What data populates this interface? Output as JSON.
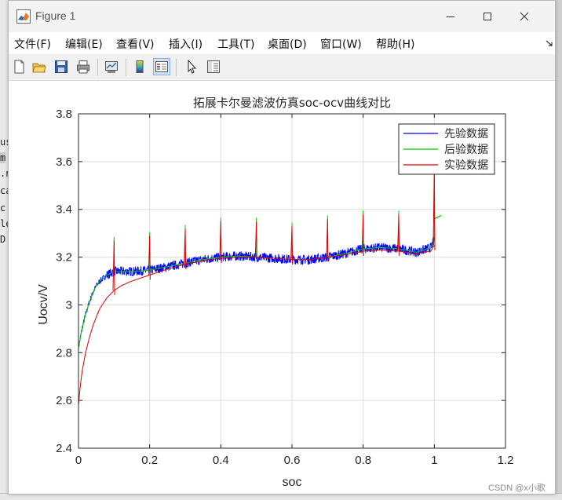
{
  "window": {
    "title": "Figure 1",
    "menu": [
      "文件(F)",
      "编辑(E)",
      "查看(V)",
      "插入(I)",
      "工具(T)",
      "桌面(D)",
      "窗口(W)",
      "帮助(H)"
    ]
  },
  "background_fragments": [
    "us",
    "m",
    ".n",
    "ca",
    "c.",
    "le",
    "D"
  ],
  "watermark": "CSDN @x小歌",
  "colors": {
    "series1": "#0000ff",
    "series2": "#00cc00",
    "series3": "#dd0000",
    "grid": "#dcdcdc"
  },
  "toolbar_icons": [
    "new-figure-icon",
    "open-file-icon",
    "save-icon",
    "print-icon",
    "link-plot-icon",
    "colorbar-icon",
    "legend-icon",
    "pointer-icon",
    "property-inspector-icon"
  ],
  "chart_data": {
    "type": "line",
    "title": "拓展卡尔曼滤波仿真soc-ocv曲线对比",
    "xlabel": "soc",
    "ylabel": "Uocv/V",
    "xlim": [
      0,
      1.2
    ],
    "ylim": [
      2.4,
      3.8
    ],
    "xticks": [
      0,
      0.2,
      0.4,
      0.6,
      0.8,
      1,
      1.2
    ],
    "xtick_labels": [
      "0",
      "0.2",
      "0.4",
      "0.6",
      "0.8",
      "1",
      "1.2"
    ],
    "yticks": [
      2.4,
      2.6,
      2.8,
      3.0,
      3.2,
      3.4,
      3.6,
      3.8
    ],
    "ytick_labels": [
      "2.4",
      "2.6",
      "2.8",
      "3",
      "3.2",
      "3.4",
      "3.6",
      "3.8"
    ],
    "grid": true,
    "legend_position": "top-right",
    "series": [
      {
        "name": "先验数据",
        "color": "#0000ff",
        "noise": 0.02,
        "x": [
          0,
          0.01,
          0.02,
          0.03,
          0.04,
          0.05,
          0.06,
          0.08,
          0.1,
          0.12,
          0.15,
          0.2,
          0.25,
          0.3,
          0.35,
          0.4,
          0.45,
          0.5,
          0.55,
          0.6,
          0.65,
          0.7,
          0.75,
          0.8,
          0.85,
          0.9,
          0.95,
          0.99,
          1.0
        ],
        "y": [
          2.82,
          2.9,
          2.96,
          3.01,
          3.05,
          3.08,
          3.1,
          3.125,
          3.14,
          3.14,
          3.14,
          3.145,
          3.16,
          3.175,
          3.19,
          3.2,
          3.205,
          3.2,
          3.195,
          3.19,
          3.19,
          3.2,
          3.215,
          3.235,
          3.24,
          3.235,
          3.22,
          3.24,
          3.27
        ]
      },
      {
        "name": "后验数据",
        "color": "#00cc00",
        "x": [
          0,
          0.01,
          0.02,
          0.03,
          0.04,
          0.05,
          0.06,
          0.08,
          0.1,
          0.12,
          0.15,
          0.2,
          0.25,
          0.3,
          0.35,
          0.4,
          0.45,
          0.5,
          0.55,
          0.6,
          0.65,
          0.7,
          0.75,
          0.8,
          0.85,
          0.9,
          0.95,
          0.99,
          1.0
        ],
        "y": [
          2.82,
          2.9,
          2.96,
          3.01,
          3.05,
          3.08,
          3.1,
          3.125,
          3.14,
          3.14,
          3.14,
          3.145,
          3.16,
          3.175,
          3.19,
          3.2,
          3.205,
          3.2,
          3.195,
          3.19,
          3.19,
          3.2,
          3.215,
          3.235,
          3.24,
          3.235,
          3.22,
          3.24,
          3.27
        ],
        "tail_x": [
          1.0,
          1.02
        ],
        "tail_y": [
          3.36,
          3.375
        ]
      },
      {
        "name": "实验数据",
        "color": "#dd0000",
        "x": [
          0,
          0.005,
          0.01,
          0.02,
          0.03,
          0.04,
          0.05,
          0.06,
          0.08,
          0.1,
          0.12,
          0.15,
          0.2,
          0.25,
          0.3,
          0.35,
          0.4,
          0.45,
          0.5,
          0.55,
          0.6,
          0.65,
          0.7,
          0.75,
          0.8,
          0.85,
          0.9,
          0.95,
          0.99,
          1.0
        ],
        "y": [
          2.58,
          2.66,
          2.72,
          2.8,
          2.86,
          2.91,
          2.95,
          2.985,
          3.03,
          3.06,
          3.08,
          3.1,
          3.125,
          3.15,
          3.17,
          3.185,
          3.195,
          3.2,
          3.2,
          3.195,
          3.19,
          3.19,
          3.2,
          3.21,
          3.225,
          3.23,
          3.225,
          3.215,
          3.225,
          3.25
        ],
        "spikes": [
          {
            "x": 0.1,
            "y": 3.27
          },
          {
            "x": 0.2,
            "y": 3.29
          },
          {
            "x": 0.3,
            "y": 3.32
          },
          {
            "x": 0.4,
            "y": 3.35
          },
          {
            "x": 0.5,
            "y": 3.35
          },
          {
            "x": 0.6,
            "y": 3.33
          },
          {
            "x": 0.7,
            "y": 3.36
          },
          {
            "x": 0.8,
            "y": 3.38
          },
          {
            "x": 0.9,
            "y": 3.38
          },
          {
            "x": 1.0,
            "y": 3.58
          }
        ]
      }
    ]
  }
}
